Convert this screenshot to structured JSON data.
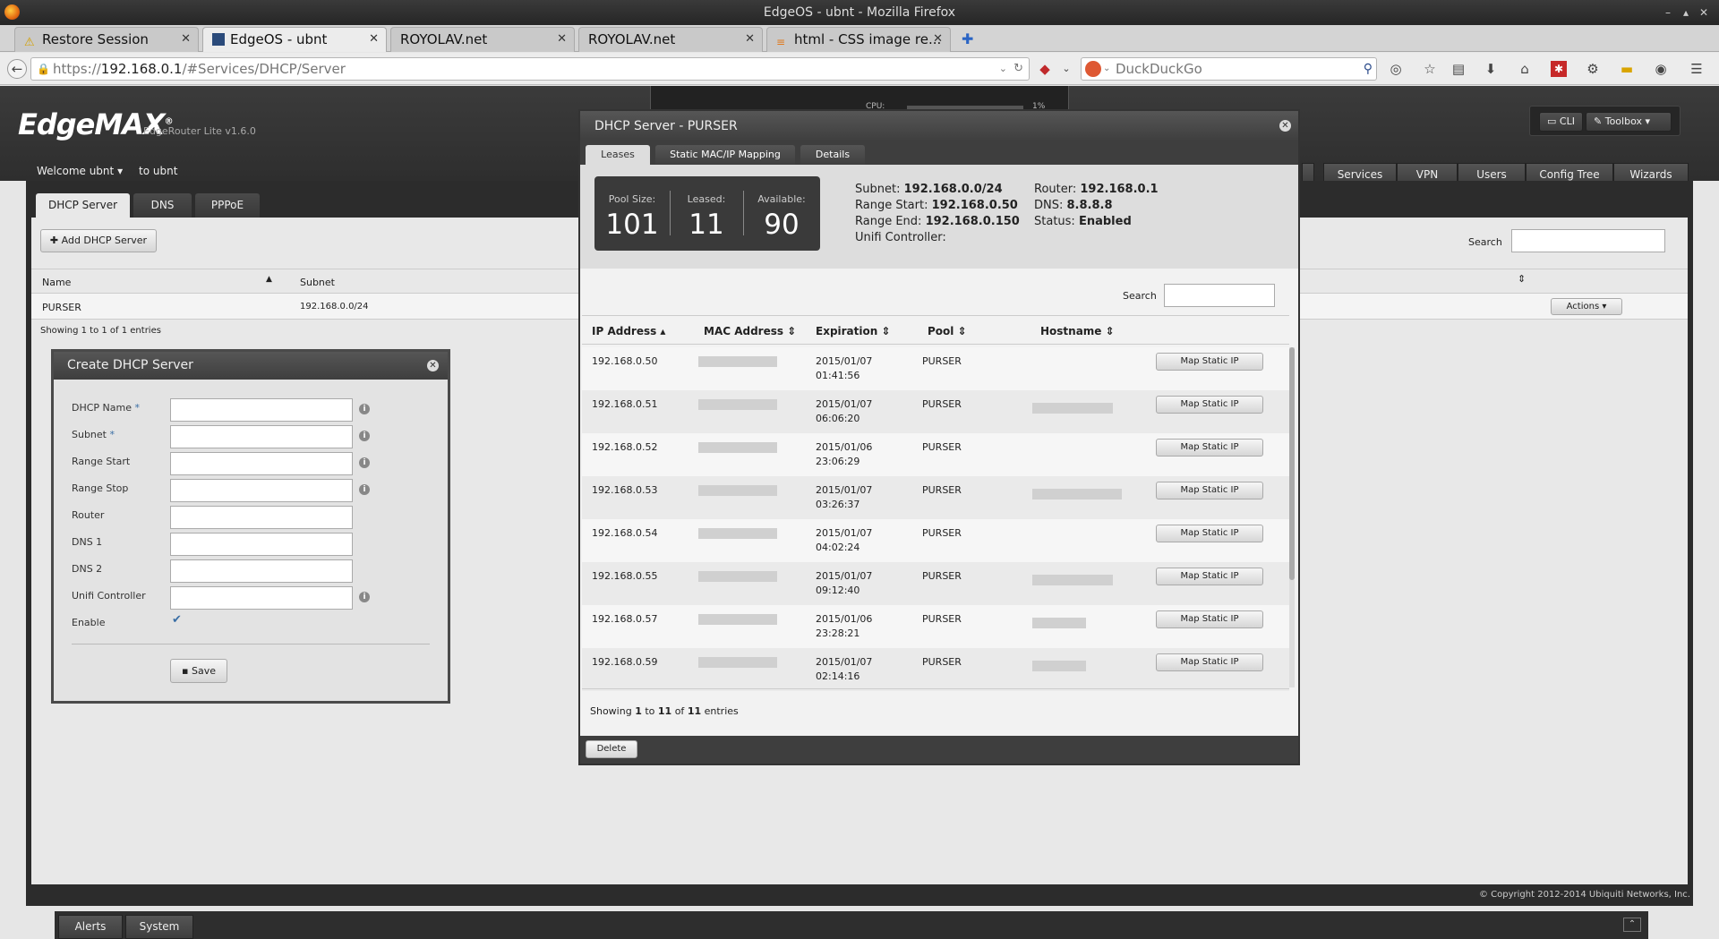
{
  "window": {
    "title": "EdgeOS - ubnt - Mozilla Firefox"
  },
  "tabs": [
    {
      "label": "Restore Session"
    },
    {
      "label": "EdgeOS - ubnt"
    },
    {
      "label": "ROYOLAV.net"
    },
    {
      "label": "ROYOLAV.net"
    },
    {
      "label": "html - CSS image re..."
    }
  ],
  "nav": {
    "url_prefix": "https://",
    "url_host": "192.168.0.1",
    "url_path": "/#Services/DHCP/Server",
    "search_placeholder": "DuckDuckGo"
  },
  "app": {
    "logo": "EdgeMAX",
    "model": "EdgeRouter Lite v1.6.0",
    "welcome": "Welcome ubnt",
    "to_user": "to ubnt",
    "cli_label": "CLI",
    "toolbox_label": "Toolbox",
    "cpu_label": "CPU:",
    "cpu_value": "1%",
    "main_tabs": [
      "Services",
      "VPN",
      "Users",
      "Config Tree",
      "Wizards"
    ]
  },
  "services": {
    "subtabs": [
      "DHCP Server",
      "DNS",
      "PPPoE"
    ],
    "add_button": "Add DHCP Server",
    "search_label": "Search",
    "col_name": "Name",
    "col_subnet": "Subnet",
    "row_name": "PURSER",
    "row_subnet": "192.168.0.0/24",
    "actions_label": "Actions",
    "showing": "Showing 1 to 1 of 1 entries"
  },
  "create_dialog": {
    "title": "Create DHCP Server",
    "fields": [
      "DHCP Name",
      "Subnet",
      "Range Start",
      "Range Stop",
      "Router",
      "DNS 1",
      "DNS 2",
      "Unifi Controller",
      "Enable"
    ],
    "save": "Save"
  },
  "modal": {
    "title": "DHCP Server - PURSER",
    "tabs": [
      "Leases",
      "Static MAC/IP Mapping",
      "Details"
    ],
    "pool_size_label": "Pool Size:",
    "pool_size": "101",
    "leased_label": "Leased:",
    "leased": "11",
    "available_label": "Available:",
    "available": "90",
    "subnet_label": "Subnet:",
    "subnet": "192.168.0.0/24",
    "range_start_label": "Range Start:",
    "range_start": "192.168.0.50",
    "range_end_label": "Range End:",
    "range_end": "192.168.0.150",
    "unifi_label": "Unifi Controller:",
    "router_label": "Router:",
    "router": "192.168.0.1",
    "dns_label": "DNS:",
    "dns": "8.8.8.8",
    "status_label": "Status:",
    "status": "Enabled",
    "search_label": "Search",
    "columns": [
      "IP Address",
      "MAC Address",
      "Expiration",
      "Pool",
      "Hostname"
    ],
    "map_button": "Map Static IP",
    "leases": [
      {
        "ip": "192.168.0.50",
        "date": "2015/01/07",
        "time": "01:41:56",
        "pool": "PURSER"
      },
      {
        "ip": "192.168.0.51",
        "date": "2015/01/07",
        "time": "06:06:20",
        "pool": "PURSER"
      },
      {
        "ip": "192.168.0.52",
        "date": "2015/01/06",
        "time": "23:06:29",
        "pool": "PURSER"
      },
      {
        "ip": "192.168.0.53",
        "date": "2015/01/07",
        "time": "03:26:37",
        "pool": "PURSER"
      },
      {
        "ip": "192.168.0.54",
        "date": "2015/01/07",
        "time": "04:02:24",
        "pool": "PURSER"
      },
      {
        "ip": "192.168.0.55",
        "date": "2015/01/07",
        "time": "09:12:40",
        "pool": "PURSER"
      },
      {
        "ip": "192.168.0.57",
        "date": "2015/01/06",
        "time": "23:28:21",
        "pool": "PURSER"
      },
      {
        "ip": "192.168.0.59",
        "date": "2015/01/07",
        "time": "02:14:16",
        "pool": "PURSER"
      }
    ],
    "showing_pre": "Showing ",
    "showing_from": "1",
    "showing_mid1": " to ",
    "showing_to": "11",
    "showing_mid2": " of ",
    "showing_total": "11",
    "showing_post": " entries",
    "delete": "Delete"
  },
  "footer": {
    "copyright": "© Copyright 2012-2014 Ubiquiti Networks, Inc.",
    "alerts": "Alerts",
    "system": "System"
  }
}
